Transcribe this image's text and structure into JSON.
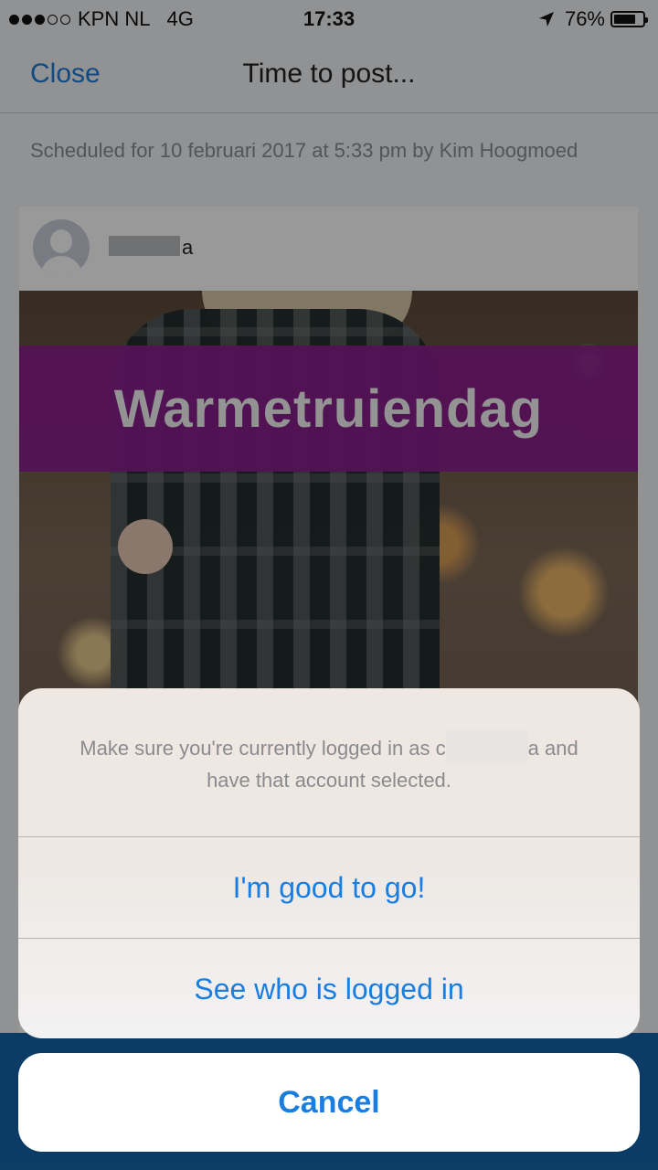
{
  "status_bar": {
    "carrier": "KPN NL",
    "network": "4G",
    "time": "17:33",
    "battery_percent": "76%",
    "battery_level": 0.76,
    "signal_bars_filled": 3,
    "signal_bars_total": 5
  },
  "nav": {
    "close_label": "Close",
    "title": "Time to post..."
  },
  "schedule_text": "Scheduled for 10 februari 2017 at 5:33 pm by Kim Hoogmoed",
  "post": {
    "account_name_suffix": "a",
    "banner_text": "Warmetruiendag"
  },
  "sheet": {
    "message_line1_start": "Make sure you're currently logged in as ",
    "message_redacted_char": "c",
    "message_line1_end": "a and",
    "message_line2": "have that account selected.",
    "button_good": "I'm good to go!",
    "button_see": "See who is logged in",
    "button_cancel": "Cancel"
  },
  "colors": {
    "accent": "#1a7de0",
    "banner": "#8c1f8f",
    "bottom_bar": "#1565a8"
  }
}
